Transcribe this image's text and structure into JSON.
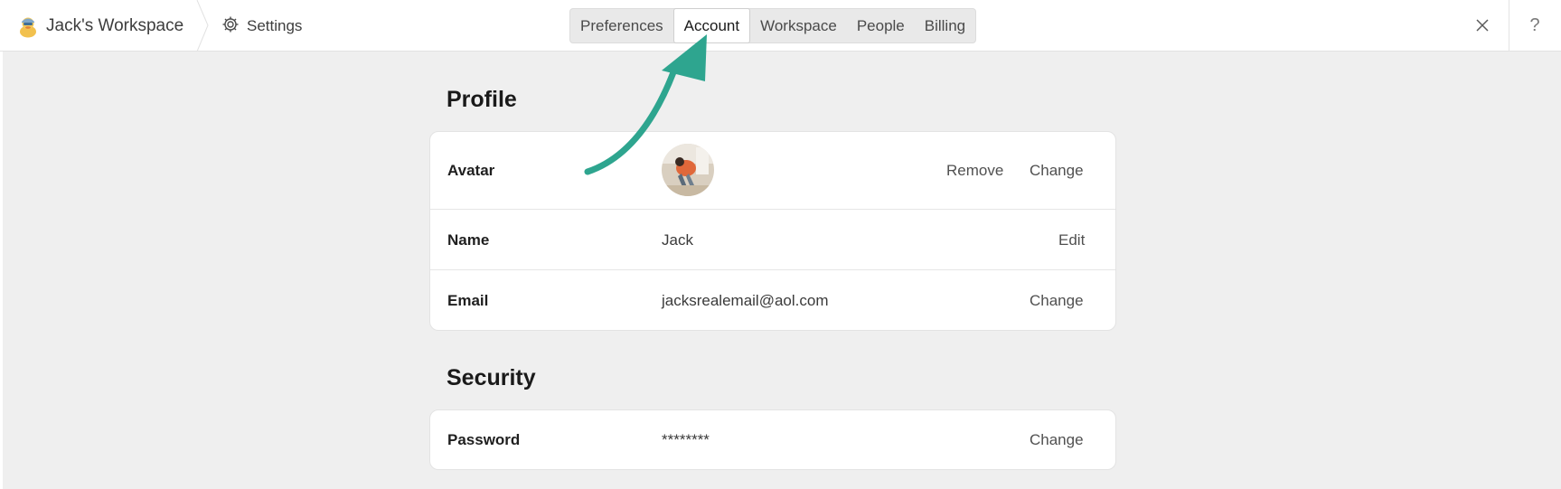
{
  "header": {
    "workspace_name": "Jack's Workspace",
    "settings_label": "Settings",
    "tabs": [
      {
        "label": "Preferences",
        "active": false
      },
      {
        "label": "Account",
        "active": true
      },
      {
        "label": "Workspace",
        "active": false
      },
      {
        "label": "People",
        "active": false
      },
      {
        "label": "Billing",
        "active": false
      }
    ],
    "help_label": "?",
    "icons": {
      "workspace": "duck-avatar-icon",
      "settings": "gear-icon",
      "close": "close-icon",
      "help": "help-icon"
    }
  },
  "profile": {
    "title": "Profile",
    "avatar": {
      "label": "Avatar",
      "remove_label": "Remove",
      "change_label": "Change"
    },
    "name": {
      "label": "Name",
      "value": "Jack",
      "action": "Edit"
    },
    "email": {
      "label": "Email",
      "value": "jacksrealemail@aol.com",
      "action": "Change"
    }
  },
  "security": {
    "title": "Security",
    "password": {
      "label": "Password",
      "value": "********",
      "action": "Change"
    }
  },
  "colors": {
    "accent_arrow": "#2ea58f",
    "background": "#efefef",
    "card": "#ffffff"
  }
}
